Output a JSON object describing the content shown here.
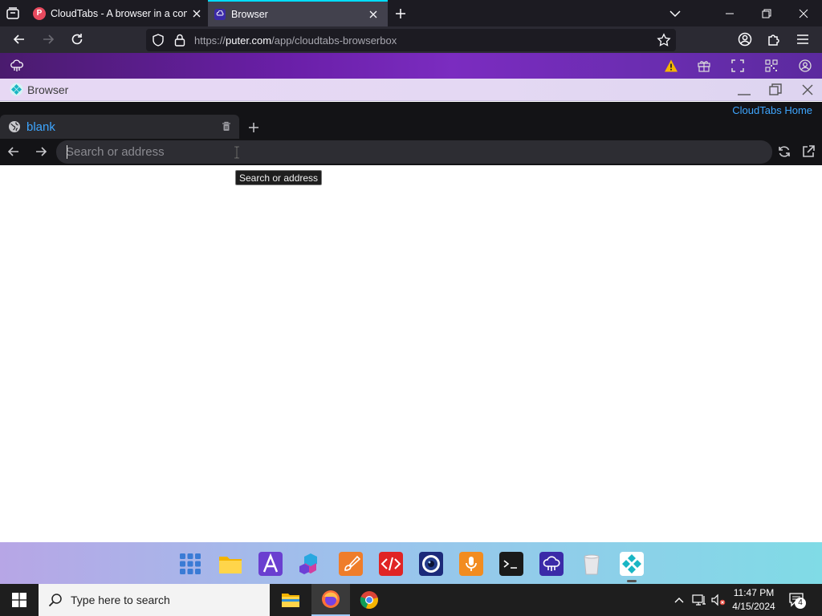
{
  "firefox": {
    "tabs": [
      {
        "title": "CloudTabs - A browser in a com",
        "favicon": "puter-p-icon",
        "active": false
      },
      {
        "title": "Browser",
        "favicon": "puter-cloud-icon",
        "active": true
      }
    ],
    "url": {
      "prefix": "https://",
      "domain": "puter.com",
      "path": "/app/cloudtabs-browserbox"
    }
  },
  "window": {
    "title": "Browser"
  },
  "cloudtabs": {
    "home_link": "CloudTabs Home",
    "tab_label": "blank",
    "address_placeholder": "Search or address",
    "tooltip": "Search or address"
  },
  "taskbar": {
    "search_placeholder": "Type here to search",
    "time": "11:47 PM",
    "date": "4/15/2024",
    "notification_count": "4"
  },
  "colors": {
    "link_blue": "#3ea6ff",
    "puter_purple": "#6a1fa8",
    "warning": "#f5b400"
  }
}
